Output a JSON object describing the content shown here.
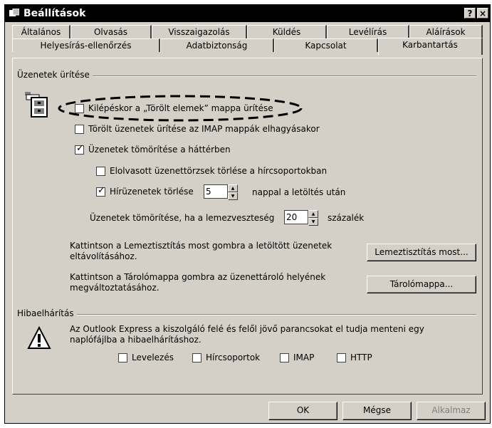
{
  "window": {
    "title": "Beállítások",
    "help_label": "?",
    "close_label": "×"
  },
  "tabs": {
    "row1": [
      "Általános",
      "Olvasás",
      "Visszaigazolás",
      "Küldés",
      "Levélírás",
      "Aláírások"
    ],
    "row2": [
      "Helyesírás-ellenőrzés",
      "Adatbiztonság",
      "Kapcsolat",
      "Karbantartás"
    ],
    "active": "Karbantartás"
  },
  "cleanup": {
    "group_title": "Üzenetek ürítése",
    "empty_deleted": {
      "label": "Kilépéskor a „Törölt elemek” mappa ürítése",
      "checked": false
    },
    "purge_imap": {
      "label": "Törölt üzenetek ürítése az IMAP mappák elhagyásakor",
      "checked": false
    },
    "compact_bg": {
      "label": "Üzenetek tömörítése a háttérben",
      "checked": true
    },
    "delete_read_bodies": {
      "label": "Elolvasott üzenettörzsek törlése a hírcsoportokban",
      "checked": false
    },
    "delete_news": {
      "label": "Hírüzenetek törlése",
      "checked": true,
      "days": "5",
      "suffix": "nappal a letöltés után"
    },
    "compact_when": {
      "label": "Üzenetek tömörítése, ha a lemezveszteség",
      "value": "20",
      "suffix": "százalék"
    },
    "cleanup_text": "Kattintson a Lemeztisztítás most gombra a letöltött üzenetek eltávolításához.",
    "cleanup_button": "Lemeztisztítás most...",
    "store_text": "Kattintson a Tárolómappa gombra az üzenettároló helyének megváltoztatásához.",
    "store_button": "Tárolómappa..."
  },
  "troubleshoot": {
    "group_title": "Hibaelhárítás",
    "text": "Az Outlook Express a kiszolgáló felé és felől jövő parancsokat el tudja menteni egy naplófájlba a hibaelhárításhoz.",
    "options": [
      {
        "label": "Levelezés",
        "checked": false
      },
      {
        "label": "Hírcsoportok",
        "checked": false
      },
      {
        "label": "IMAP",
        "checked": false
      },
      {
        "label": "HTTP",
        "checked": false
      }
    ]
  },
  "footer": {
    "ok": "OK",
    "cancel": "Mégse",
    "apply": "Alkalmaz"
  },
  "icons": {
    "title": "settings-window-icon",
    "recycle": "recycle-bin-icon",
    "warning": "warning-icon"
  }
}
